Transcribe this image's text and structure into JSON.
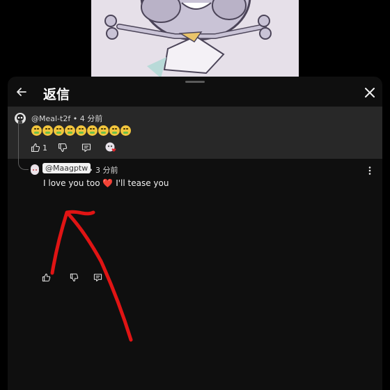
{
  "header": {
    "title": "返信"
  },
  "parent_comment": {
    "author": "@Meal-t2f",
    "time": "• 4 分前",
    "emoji_count": 9,
    "like_count": "1"
  },
  "reply_comment": {
    "mention": "@Maagptw",
    "time": "• 3 分前",
    "text_before": "I love you too",
    "heart": "❤️",
    "text_after": "I'll tease you"
  },
  "colors": {
    "panel": "#0f0f0f",
    "parent_bg": "#282828",
    "annotation": "#e01414"
  },
  "icons": [
    "back-arrow-icon",
    "close-icon",
    "thumbs-up-icon",
    "thumbs-down-icon",
    "reply-icon",
    "creator-heart-icon",
    "more-vert-icon"
  ]
}
